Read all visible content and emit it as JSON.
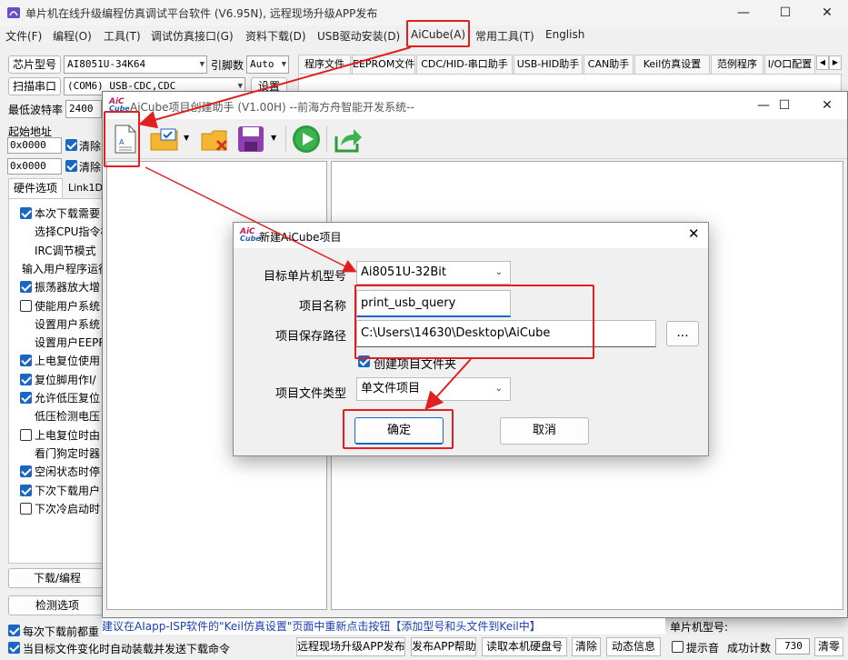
{
  "main_window": {
    "title": "单片机在线升级编程仿真调试平台软件 (V6.95N), 远程现场升级APP发布",
    "menu": [
      "文件(F)",
      "编程(O)",
      "工具(T)",
      "调试仿真接口(G)",
      "资料下载(D)",
      "USB驱动安装(D)",
      "AiCube(A)",
      "常用工具(T)",
      "English"
    ]
  },
  "left_panel": {
    "chip_label": "芯片型号",
    "chip_value": "AI8051U-34K64",
    "pin_label": "引脚数",
    "pin_value": "Auto",
    "scan_label": "扫描串口",
    "port_value": "(COM6) USB-CDC,CDC",
    "settings_label": "设置",
    "baud_label": "最低波特率",
    "baud_value": "2400",
    "start_addr_label": "起始地址",
    "addr1": "0x0000",
    "addr2": "0x0000",
    "clear1": "清除",
    "clear2": "清除",
    "tabs": [
      "硬件选项",
      "Link1D"
    ],
    "options": [
      {
        "text": "本次下载需要",
        "checked": true,
        "indent": false
      },
      {
        "text": "选择CPU指令核",
        "checked": null,
        "indent": true
      },
      {
        "text": "IRC调节模式",
        "checked": null,
        "indent": true
      },
      {
        "text": "输入用户程序运行",
        "checked": null,
        "indent": false
      },
      {
        "text": "振荡器放大增",
        "checked": true,
        "indent": false
      },
      {
        "text": "使能用户系统",
        "checked": false,
        "indent": false
      },
      {
        "text": "设置用户系统",
        "checked": null,
        "indent": true
      },
      {
        "text": "设置用户EEPR",
        "checked": null,
        "indent": true
      },
      {
        "text": "上电复位使用",
        "checked": true,
        "indent": false
      },
      {
        "text": "复位脚用作I/",
        "checked": true,
        "indent": false
      },
      {
        "text": "允许低压复位",
        "checked": true,
        "indent": false
      },
      {
        "text": "低压检测电压",
        "checked": null,
        "indent": true
      },
      {
        "text": "上电复位时由",
        "checked": false,
        "indent": false
      },
      {
        "text": "看门狗定时器",
        "checked": null,
        "indent": true
      },
      {
        "text": "空闲状态时停",
        "checked": true,
        "indent": false
      },
      {
        "text": "下次下载用户",
        "checked": true,
        "indent": false
      },
      {
        "text": "下次冷启动时",
        "checked": false,
        "indent": false
      }
    ],
    "download_btn": "下载/编程",
    "detect_btn": "检测选项",
    "bottom_checks": [
      "每次下载前都重",
      "当目标文件变化时自动装载并发送下载命令"
    ]
  },
  "top_tabs": [
    "程序文件",
    "EEPROM文件",
    "CDC/HID-串口助手",
    "USB-HID助手",
    "CAN助手",
    "Keil仿真设置",
    "范例程序",
    "I/O口配置"
  ],
  "aicube_window": {
    "title": "AiCube项目创建助手 (V1.00H) --前海方舟智能开发系统--",
    "logo_top": "AiC",
    "logo_bottom": "Cube"
  },
  "dialog": {
    "title": "新建AiCube项目",
    "target_label": "目标单片机型号",
    "target_value": "Ai8051U-32Bit",
    "name_label": "项目名称",
    "name_value": "print_usb_query",
    "path_label": "项目保存路径",
    "path_value": "C:\\Users\\14630\\Desktop\\AiCube",
    "browse_label": "...",
    "create_folder_label": "创建项目文件夹",
    "type_label": "项目文件类型",
    "type_value": "单文件项目",
    "ok_label": "确定",
    "cancel_label": "取消"
  },
  "status_bar": {
    "message": "建议在AIapp-ISP软件的\"Keil仿真设置\"页面中重新点击按钮【添加型号和头文件到Keil中】",
    "chip_label": "单片机型号:",
    "buttons": [
      "远程现场升级APP发布",
      "发布APP帮助",
      "读取本机硬盘号",
      "清除",
      "动态信息"
    ],
    "sound_label": "提示音",
    "count_label": "成功计数",
    "count_value": "730",
    "clear_count": "清零"
  }
}
